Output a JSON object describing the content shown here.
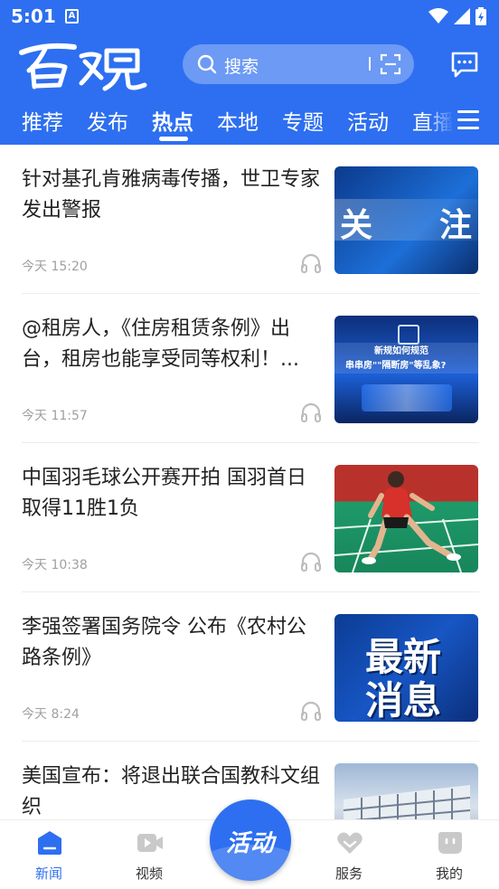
{
  "status_bar": {
    "time": "5:01",
    "app_badge": "A"
  },
  "header": {
    "logo_text": "百观",
    "search": {
      "placeholder": "搜索"
    },
    "icons": {
      "search": "search-icon",
      "scan": "scan-icon",
      "message": "message-icon"
    }
  },
  "tabs": {
    "items": [
      {
        "label": "推荐",
        "active": false
      },
      {
        "label": "发布",
        "active": false
      },
      {
        "label": "热点",
        "active": true
      },
      {
        "label": "本地",
        "active": false
      },
      {
        "label": "专题",
        "active": false
      },
      {
        "label": "活动",
        "active": false
      },
      {
        "label": "直播",
        "active": false
      }
    ],
    "menu_icon": "menu-icon"
  },
  "news": [
    {
      "title": "针对基孔肯雅病毒传播，世卫专家发出警报",
      "time": "今天 15:20",
      "thumb_text": [
        "关",
        "注"
      ]
    },
    {
      "title": "@租房人，《住房租赁条例》出台，租房也能享受同等权利！...",
      "time": "今天 11:57",
      "thumb_text": [
        "新规如何规范",
        "串串房\"\"隔断房\"等乱象?"
      ]
    },
    {
      "title": "中国羽毛球公开赛开拍 国羽首日取得11胜1负",
      "time": "今天 10:38",
      "thumb_text": []
    },
    {
      "title": "李强签署国务院令 公布《农村公路条例》",
      "time": "今天 8:24",
      "thumb_text": [
        "最新",
        "消息"
      ]
    },
    {
      "title": "美国宣布：将退出联合国教科文组织",
      "time": "",
      "thumb_text": []
    }
  ],
  "bottom_nav": {
    "items": [
      {
        "label": "新闻",
        "icon": "news-icon",
        "active": true
      },
      {
        "label": "视频",
        "icon": "video-icon",
        "active": false
      },
      {
        "label": "服务",
        "icon": "service-heart-icon",
        "active": false
      },
      {
        "label": "我的",
        "icon": "profile-icon",
        "active": false
      }
    ],
    "center_label": "活动"
  },
  "colors": {
    "brand": "#2d6ff0",
    "title_text": "#222222",
    "meta_text": "#a0a0a0"
  }
}
